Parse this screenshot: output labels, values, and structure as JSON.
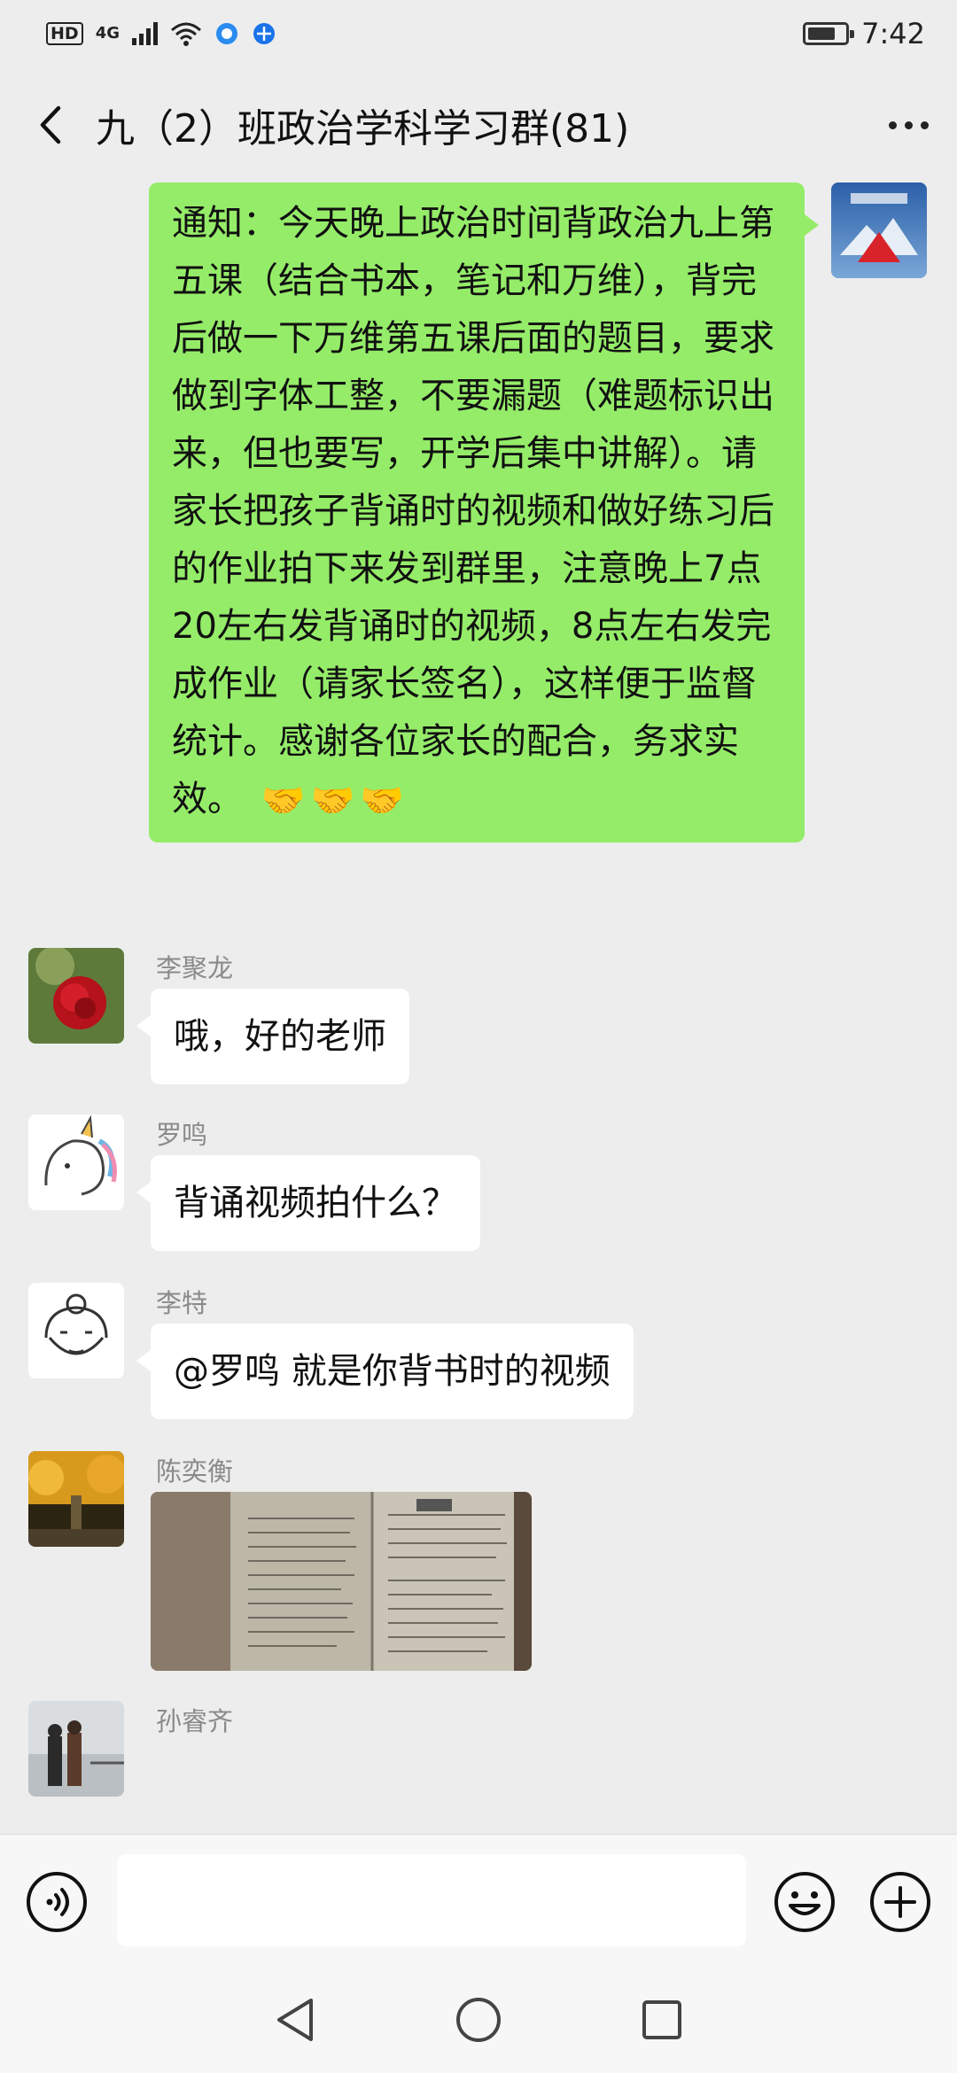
{
  "status_bar": {
    "hd_label": "HD",
    "network_label": "4G",
    "time": "7:42"
  },
  "nav": {
    "title": "九（2）班政治学科学习群(81)"
  },
  "messages": [
    {
      "id": "m1",
      "direction": "out",
      "text": "通知：今天晚上政治时间背政治九上第五课（结合书本，笔记和万维），背完后做一下万维第五课后面的题目，要求做到字体工整，不要漏题（难题标识出来，但也要写，开学后集中讲解）。请家长把孩子背诵时的视频和做好练习后的作业拍下来发到群里，注意晚上7点20左右发背诵时的视频，8点左右发完成作业（请家长签名），这样便于监督统计。感谢各位家长的配合，务求实效。",
      "emoji": [
        "🤝",
        "🤝",
        "🤝"
      ]
    },
    {
      "id": "m2",
      "direction": "in",
      "sender": "李聚龙",
      "text": "哦，好的老师"
    },
    {
      "id": "m3",
      "direction": "in",
      "sender": "罗鸣",
      "text": "背诵视频拍什么？"
    },
    {
      "id": "m4",
      "direction": "in",
      "sender": "李特",
      "text": "@罗鸣  就是你背书时的视频"
    },
    {
      "id": "m5",
      "direction": "in",
      "sender": "陈奕衡",
      "type": "image"
    },
    {
      "id": "m6",
      "direction": "in",
      "sender": "孙睿齐"
    }
  ],
  "input": {
    "placeholder": ""
  },
  "icons": {
    "back": "chevron-left-icon",
    "more": "more-dots-icon",
    "voice": "voice-icon",
    "emoji": "emoji-icon",
    "plus": "plus-icon",
    "sys_back": "triangle-back-icon",
    "sys_home": "circle-home-icon",
    "sys_recent": "square-recent-icon"
  },
  "colors": {
    "background": "#ededed",
    "outgoing_bubble": "#95ec69",
    "incoming_bubble": "#ffffff",
    "sender_name": "#8a8a8a"
  }
}
